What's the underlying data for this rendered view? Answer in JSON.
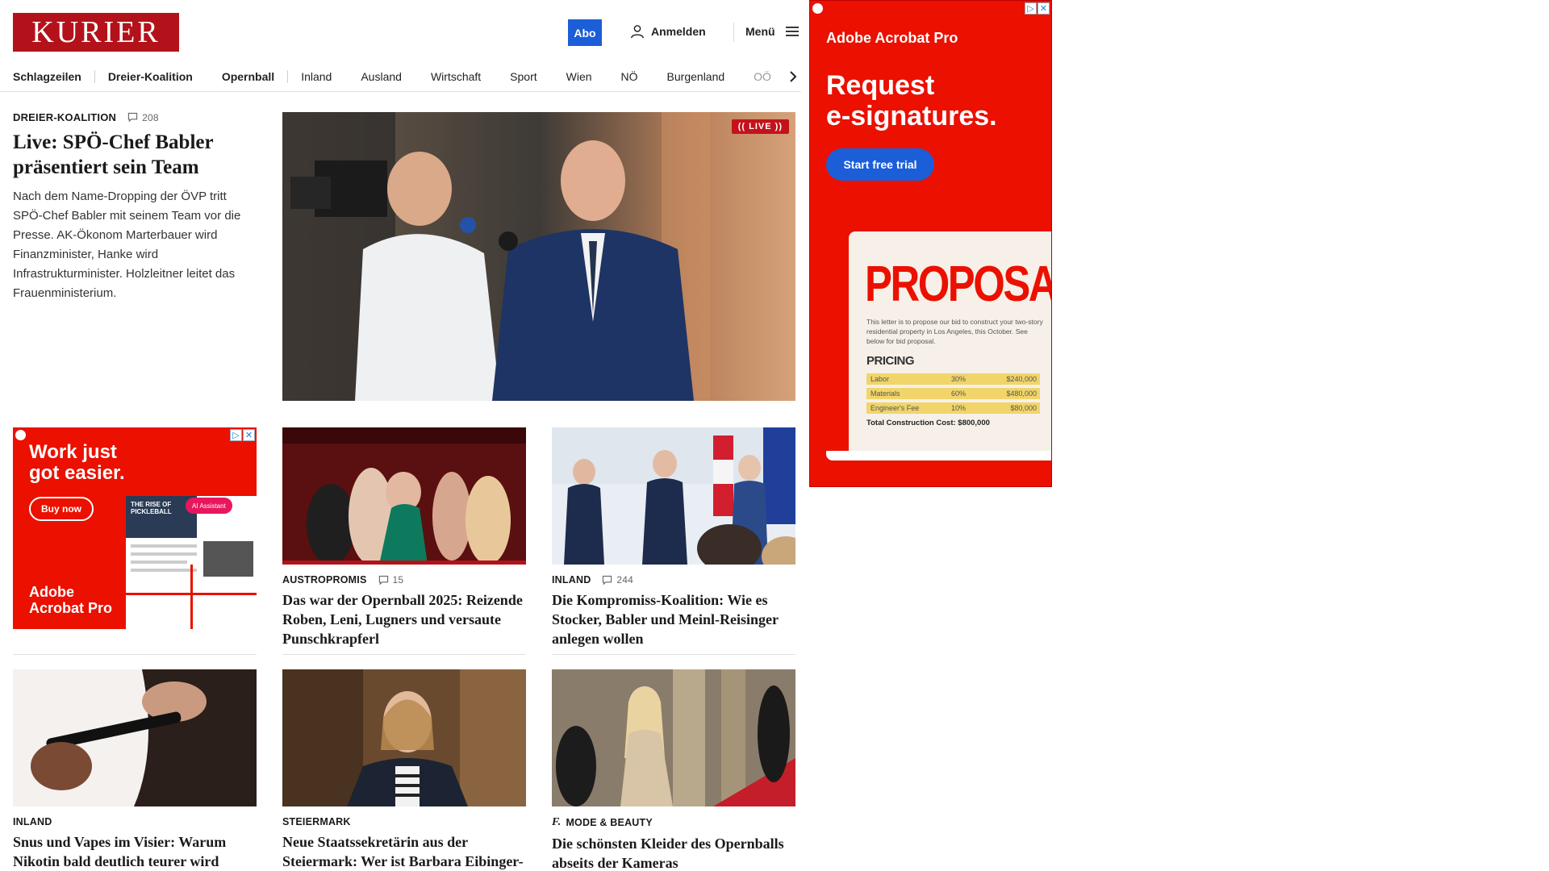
{
  "header": {
    "logo_text": "KURIER",
    "abo_label": "Abo",
    "login_label": "Anmelden",
    "menu_label": "Menü"
  },
  "nav": {
    "items": [
      "Schlagzeilen",
      "Dreier-Koalition",
      "Opernball",
      "Inland",
      "Ausland",
      "Wirtschaft",
      "Sport",
      "Wien",
      "NÖ",
      "Burgenland",
      "OÖ"
    ]
  },
  "hero": {
    "category": "DREIER-KOALITION",
    "comments": "208",
    "title": "Live: SPÖ-Chef Babler präsentiert sein Team",
    "lead": "Nach dem Name-Dropping der ÖVP tritt SPÖ-Chef Babler mit seinem Team vor die Presse. AK-Ökonom Marterbauer wird Finanzminister, Hanke wird Infrastrukturminister. Holzleitner leitet das Frauenministerium.",
    "live_label": "LIVE"
  },
  "cards": [
    {
      "category": "AUSTROPROMIS",
      "comments": "15",
      "title": "Das war der Opernball 2025: Reizende Roben, Leni, Lugners und versaute Punschkrapferl"
    },
    {
      "category": "INLAND",
      "comments": "244",
      "title": "Die Kompromiss-Koalition: Wie es Stocker, Babler und Meinl-Reisinger anlegen wollen"
    },
    {
      "category": "INLAND",
      "title": "Snus und Vapes im Visier: Warum Nikotin bald deutlich teurer wird"
    },
    {
      "category": "STEIERMARK",
      "title": "Neue Staatssekretärin aus der Steiermark: Wer ist Barbara Eibinger-Miedl?"
    },
    {
      "category": "MODE & BEAUTY",
      "title": "Die schönsten Kleider des Opernballs abseits der Kameras"
    }
  ],
  "ad_small": {
    "headline_1": "Work just",
    "headline_2": "got easier.",
    "button": "Buy now",
    "brand_1": "Adobe",
    "brand_2": "Acrobat Pro",
    "doc_title_1": "THE RISE OF",
    "doc_title_2": "PICKLEBALL",
    "assistant_label": "AI Assistant"
  },
  "ad_right": {
    "brand": "Adobe Acrobat Pro",
    "headline_1": "Request",
    "headline_2": "e-signatures.",
    "button": "Start free trial",
    "doc_title": "PROPOSAL",
    "doc_text": "This letter is to propose our bid to construct your two-story residential property in Los Angeles, this October. See below for bid proposal.",
    "pricing_label": "PRICING",
    "rows": [
      {
        "item": "Labor",
        "pct": "30%",
        "amount": "$240,000"
      },
      {
        "item": "Materials",
        "pct": "60%",
        "amount": "$480,000"
      },
      {
        "item": "Engineer's Fee",
        "pct": "10%",
        "amount": "$80,000"
      }
    ],
    "total": "Total Construction Cost: $800,000"
  },
  "colors": {
    "brand_red": "#b3121a",
    "abo_blue": "#1b5ed8",
    "adobe_red": "#eb1000",
    "live_red": "#c4121b"
  }
}
